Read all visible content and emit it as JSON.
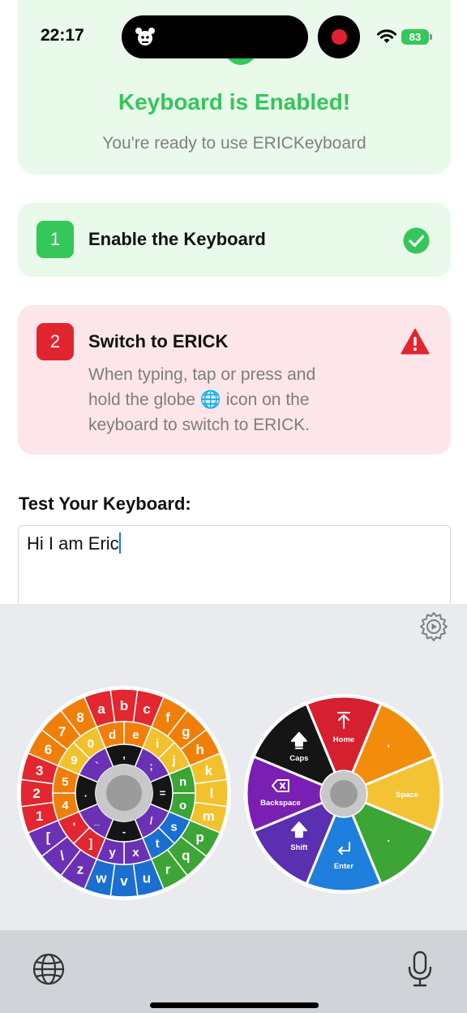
{
  "status_bar": {
    "time": "22:17",
    "battery": "83"
  },
  "enabled_card": {
    "title": "Keyboard is Enabled!",
    "subtitle": "You're ready to use ERICKeyboard"
  },
  "steps": [
    {
      "number": "1",
      "title": "Enable the Keyboard",
      "status": "complete"
    },
    {
      "number": "2",
      "title": "Switch to ERICK",
      "status": "warning",
      "description_lines": [
        "When typing, tap or press and",
        "hold the globe 🌐 icon on the",
        "keyboard to switch to ERICK."
      ]
    }
  ],
  "test": {
    "label": "Test Your Keyboard:",
    "value": "Hi I am Eric"
  },
  "letter_wheel": {
    "outer": [
      "a",
      "b",
      "c",
      "f",
      "g",
      "h",
      "k",
      "l",
      "m",
      "p",
      "q",
      "r",
      "u",
      "v",
      "w",
      "z",
      "\\",
      "[",
      "1",
      "2",
      "3",
      "6",
      "7",
      "8"
    ],
    "middle": [
      "d",
      "e",
      "i",
      "j",
      "n",
      "o",
      "s",
      "t",
      "x",
      "y",
      "]",
      "'",
      "4",
      "5",
      "9",
      "0"
    ],
    "inner": [
      ",",
      ";",
      "=",
      "/",
      "-",
      "_",
      ".",
      "`"
    ],
    "colors": [
      "#e3262f",
      "#f07f0a",
      "#f2c12e",
      "#3ca535",
      "#1a6fd1",
      "#6a31b5"
    ]
  },
  "action_wheel": {
    "segments": [
      {
        "label": "Home",
        "icon": "home-arrow-icon",
        "color": "#d6202f"
      },
      {
        "label": "'",
        "icon": "",
        "color": "#f28c0a"
      },
      {
        "label": "Space",
        "icon": "",
        "color": "#f4c334"
      },
      {
        "label": ".",
        "icon": "",
        "color": "#3ca535"
      },
      {
        "label": "Enter",
        "icon": "enter-icon",
        "color": "#1e7fdc"
      },
      {
        "label": "Shift",
        "icon": "shift-icon",
        "color": "#5a2fb0"
      },
      {
        "label": "Backspace",
        "icon": "backspace-icon",
        "color": "#7a1fb3"
      },
      {
        "label": "Caps",
        "icon": "caps-icon",
        "color": "#151515"
      }
    ]
  }
}
